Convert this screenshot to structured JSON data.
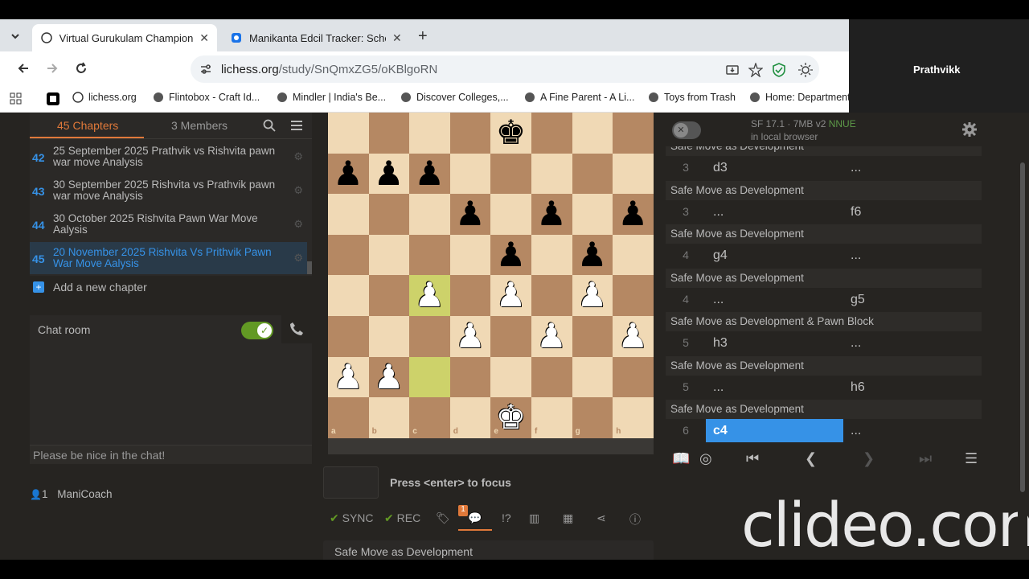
{
  "browser": {
    "tabs": [
      {
        "title": "Virtual Gurukulam Champions",
        "active": true
      },
      {
        "title": "Manikanta Edcil Tracker: Sche",
        "active": false
      }
    ],
    "url_host": "lichess.org",
    "url_path": "/study/SnQmxZG5/oKBlgoRN",
    "bookmarks": [
      "lichess.org",
      "Flintobox - Craft Id...",
      "Mindler | India's Be...",
      "Discover Colleges,...",
      "A Fine Parent - A Li...",
      "Toys from Trash",
      "Home: Department"
    ],
    "profile_name": "Prathvikk"
  },
  "study": {
    "tab_chapters": "45 Chapters",
    "tab_members": "3 Members",
    "chapters": [
      {
        "num": "42",
        "title": "25 September 2025 Prathvik vs Rishvita pawn war move Analysis"
      },
      {
        "num": "43",
        "title": "30 September 2025 Rishvita vs Prathvik pawn war move Analysis"
      },
      {
        "num": "44",
        "title": "30 October 2025 Rishvita Pawn War Move Aalysis"
      },
      {
        "num": "45",
        "title": "20 November 2025 Rishvita Vs Prithvik Pawn War Move Aalysis"
      }
    ],
    "add_chapter": "Add a new chapter",
    "chat_title": "Chat room",
    "chat_placeholder": "Please be nice in the chat!",
    "member_count": "1",
    "member_name": "ManiCoach"
  },
  "board": {
    "files": [
      "a",
      "b",
      "c",
      "d",
      "e",
      "f",
      "g",
      "h"
    ],
    "ranks": [
      "8",
      "7",
      "6",
      "5",
      "4",
      "3",
      "2",
      "1"
    ],
    "pieces": [
      {
        "sq": "e8",
        "p": "♚",
        "c": "b"
      },
      {
        "sq": "a7",
        "p": "♟",
        "c": "b"
      },
      {
        "sq": "b7",
        "p": "♟",
        "c": "b"
      },
      {
        "sq": "c7",
        "p": "♟",
        "c": "b"
      },
      {
        "sq": "d6",
        "p": "♟",
        "c": "b"
      },
      {
        "sq": "f6",
        "p": "♟",
        "c": "b"
      },
      {
        "sq": "h6",
        "p": "♟",
        "c": "b"
      },
      {
        "sq": "e5",
        "p": "♟",
        "c": "b"
      },
      {
        "sq": "g5",
        "p": "♟",
        "c": "b"
      },
      {
        "sq": "c4",
        "p": "♟",
        "c": "w"
      },
      {
        "sq": "e4",
        "p": "♟",
        "c": "w"
      },
      {
        "sq": "g4",
        "p": "♟",
        "c": "w"
      },
      {
        "sq": "d3",
        "p": "♟",
        "c": "w"
      },
      {
        "sq": "f3",
        "p": "♟",
        "c": "w"
      },
      {
        "sq": "h3",
        "p": "♟",
        "c": "w"
      },
      {
        "sq": "a2",
        "p": "♟",
        "c": "w"
      },
      {
        "sq": "b2",
        "p": "♟",
        "c": "w"
      },
      {
        "sq": "e1",
        "p": "♚",
        "c": "w"
      }
    ],
    "highlight": [
      "c4",
      "c2"
    ]
  },
  "engine": {
    "line1": "SF 17.1 · 7MB v2",
    "nnue": "NNUE",
    "line2": "in local browser"
  },
  "moves": {
    "rows": [
      {
        "comment": "Safe Move as Development",
        "num": "3",
        "white": "d3",
        "black": "..."
      },
      {
        "comment": "Safe Move as Development",
        "num": "3",
        "white": "...",
        "black": "f6"
      },
      {
        "comment": "Safe Move as Development",
        "num": "4",
        "white": "g4",
        "black": "..."
      },
      {
        "comment": "Safe Move as Development",
        "num": "4",
        "white": "...",
        "black": "g5"
      },
      {
        "comment": "Safe Move as Development & Pawn Block",
        "num": "5",
        "white": "h3",
        "black": "..."
      },
      {
        "comment": "Safe Move as Development",
        "num": "5",
        "white": "...",
        "black": "h6"
      },
      {
        "comment": "Safe Move as Development",
        "num": "6",
        "white": "c4",
        "black": "..."
      }
    ]
  },
  "toolbar": {
    "sync": "SYNC",
    "rec": "REC",
    "badge": "1",
    "focus_hint": "Press <enter> to focus",
    "comment_text": "Safe Move as Development"
  },
  "watermark": "clideo.com"
}
